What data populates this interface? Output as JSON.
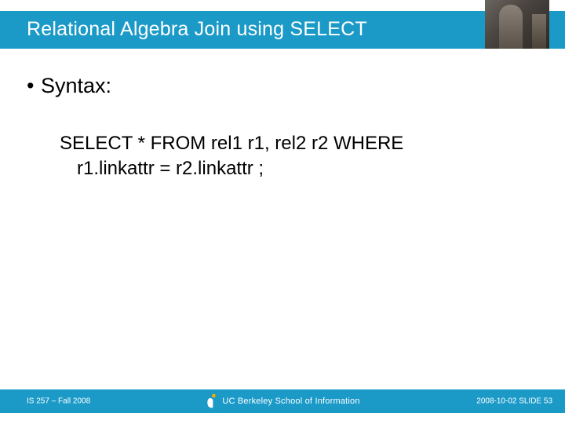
{
  "header": {
    "title": "Relational Algebra Join using SELECT"
  },
  "body": {
    "bullet_marker": "•",
    "bullet_label": "Syntax:",
    "code_line1": "SELECT  * FROM rel1 r1, rel2 r2 WHERE",
    "code_line2": "r1.linkattr = r2.linkattr ;"
  },
  "footer": {
    "left": "IS 257 – Fall 2008",
    "logo_text": "UC Berkeley School of Information",
    "right": "2008-10-02  SLIDE 53"
  }
}
